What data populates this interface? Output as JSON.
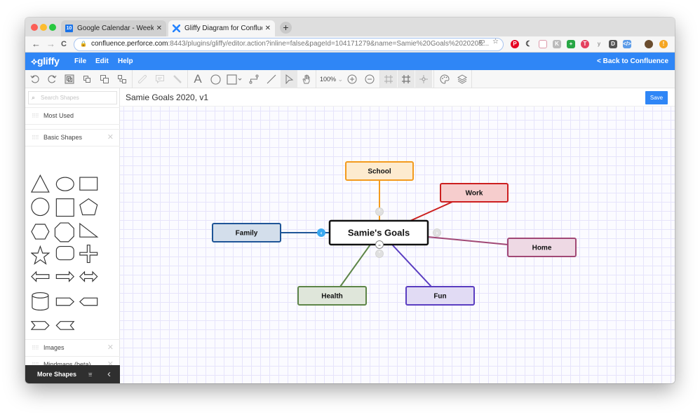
{
  "browser": {
    "tabs": [
      {
        "title": "Google Calendar - Week of Dec",
        "favicon": "calendar-icon",
        "favicon_text": "10",
        "active": false
      },
      {
        "title": "Gliffy Diagram for Confluence",
        "favicon": "confluence-icon",
        "active": true
      }
    ],
    "new_tab_label": "+",
    "close_label": "✕",
    "url_host": "confluence.perforce.com",
    "url_rest": ":8443/plugins/gliffy/editor.action?inline=false&pageId=104171279&name=Samie%20Goals%202020&...",
    "nav": {
      "back": "←",
      "forward": "→",
      "reload": "C"
    },
    "extensions": [
      "pinterest-icon",
      "moon-icon",
      "doc-icon",
      "kami-icon",
      "plus-icon",
      "todoist-icon",
      "yoast-icon",
      "pocket-icon",
      "devtools-icon",
      "avatar-icon",
      "alert-icon"
    ]
  },
  "app": {
    "logo": "gliffy",
    "menu": [
      "File",
      "Edit",
      "Help"
    ],
    "back_link": "< Back to Confluence",
    "zoom": "100%",
    "document_title": "Samie Goals 2020, v1",
    "save_label": "Save"
  },
  "sidebar": {
    "search_placeholder": "Search Shapes",
    "sections": [
      {
        "label": "Most Used",
        "closable": false
      },
      {
        "label": "Basic Shapes",
        "closable": true
      },
      {
        "label": "Images",
        "closable": true
      },
      {
        "label": "Mindmaps (beta)",
        "closable": true
      }
    ],
    "shapes": [
      "triangle",
      "ellipse",
      "rectangle",
      "circle",
      "square",
      "pentagon",
      "hexagon",
      "octagon",
      "right-triangle",
      "star",
      "rounded-rectangle",
      "cross",
      "arrow-left",
      "arrow-right",
      "arrow-double",
      "cylinder",
      "pentagon-right",
      "pentagon-left",
      "chevron-right",
      "chevron-left"
    ],
    "more_shapes_label": "More Shapes"
  },
  "diagram": {
    "center": {
      "label": "Samie's Goals"
    },
    "nodes": [
      {
        "label": "School",
        "stroke": "#f39b1e",
        "fill": "#fdebcf"
      },
      {
        "label": "Work",
        "stroke": "#cc1f1f",
        "fill": "#f6cdcd"
      },
      {
        "label": "Home",
        "stroke": "#a14875",
        "fill": "#eed9e4"
      },
      {
        "label": "Family",
        "stroke": "#1f5597",
        "fill": "#d3deeb"
      },
      {
        "label": "Health",
        "stroke": "#5d8548",
        "fill": "#dfe6da"
      },
      {
        "label": "Fun",
        "stroke": "#5a3dc1",
        "fill": "#e1dbf4"
      }
    ]
  },
  "colors": {
    "brand": "#2f86f6",
    "more_shapes_bg": "#2f2f2f",
    "handle_active": "#3aa8f0"
  }
}
